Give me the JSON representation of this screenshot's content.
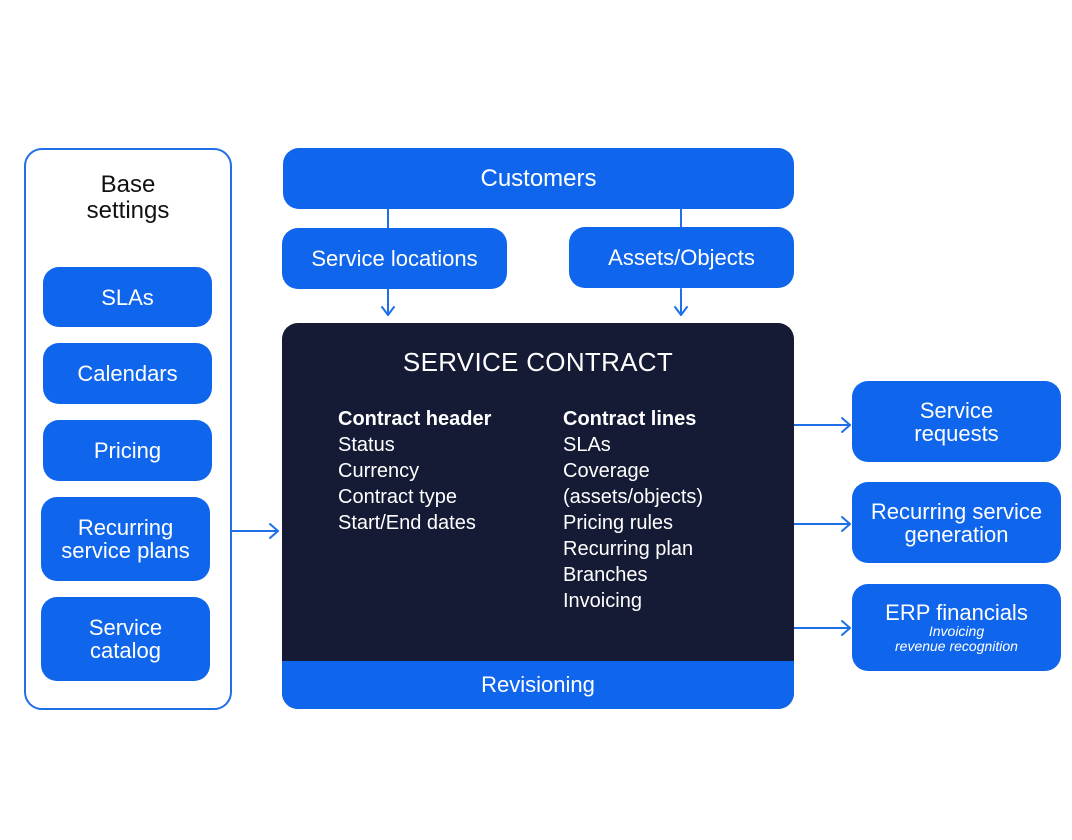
{
  "colors": {
    "accent": "#0f66ec",
    "contract_bg": "#151a35",
    "panel_border": "#1f6fe6",
    "text_dark": "#111111",
    "text_light": "#ffffff"
  },
  "base_settings": {
    "title_line1": "Base",
    "title_line2": "settings",
    "items": [
      {
        "line1": "SLAs",
        "line2": ""
      },
      {
        "line1": "Calendars",
        "line2": ""
      },
      {
        "line1": "Pricing",
        "line2": ""
      },
      {
        "line1": "Recurring",
        "line2": "service plans"
      },
      {
        "line1": "Service",
        "line2": "catalog"
      }
    ]
  },
  "top": {
    "customers": "Customers",
    "service_locations": "Service locations",
    "assets_objects": "Assets/Objects"
  },
  "contract": {
    "title": "SERVICE CONTRACT",
    "header": {
      "title": "Contract header",
      "items": [
        "Status",
        "Currency",
        "Contract type",
        "Start/End dates"
      ]
    },
    "lines": {
      "title": "Contract lines",
      "items": [
        "SLAs",
        "Coverage",
        "(assets/objects)",
        "Pricing rules",
        "Recurring plan",
        "Branches",
        "Invoicing"
      ]
    },
    "revisioning": "Revisioning"
  },
  "outputs": {
    "service_requests": {
      "line1": "Service",
      "line2": "requests"
    },
    "recurring_generation": {
      "line1": "Recurring service",
      "line2": "generation"
    },
    "erp": {
      "title": "ERP financials",
      "sub1": "Invoicing",
      "sub2": "revenue recognition"
    }
  }
}
